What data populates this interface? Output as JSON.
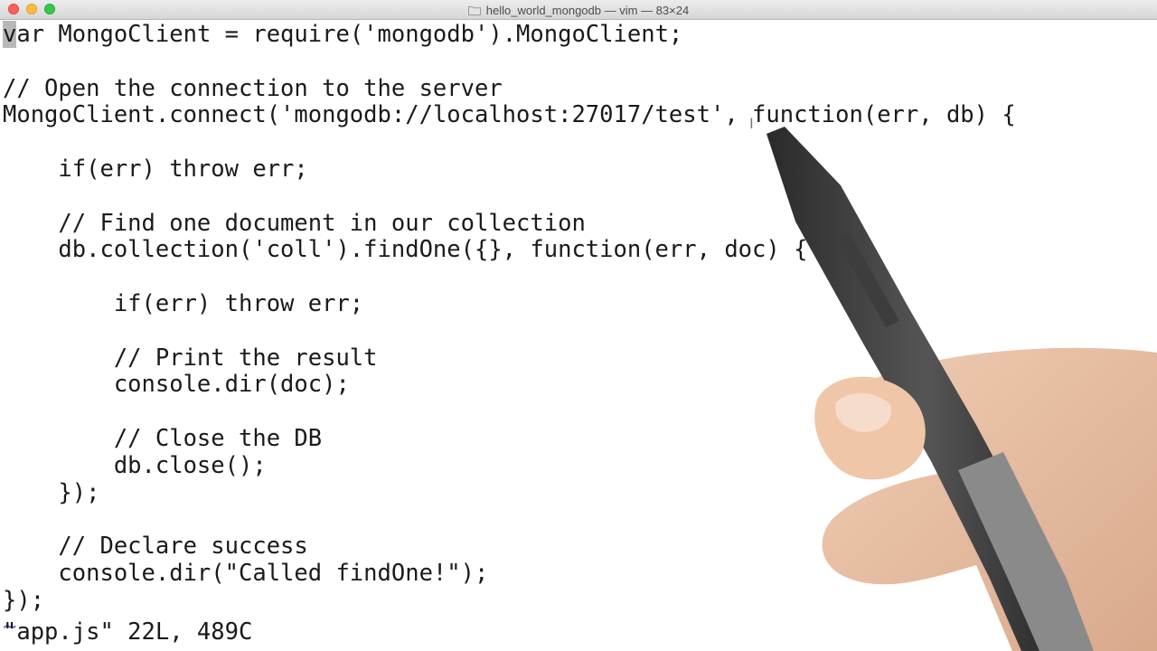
{
  "window": {
    "title": "hello_world_mongodb — vim — 83×24"
  },
  "editor": {
    "lines": [
      {
        "indent": "",
        "text": "var MongoClient = require('mongodb').MongoClient;"
      },
      {
        "indent": "",
        "text": ""
      },
      {
        "indent": "",
        "text": "// Open the connection to the server"
      },
      {
        "indent": "",
        "text": "MongoClient.connect('mongodb://localhost:27017/test', function(err, db) {"
      },
      {
        "indent": "",
        "text": ""
      },
      {
        "indent": "    ",
        "text": "if(err) throw err;"
      },
      {
        "indent": "",
        "text": ""
      },
      {
        "indent": "    ",
        "text": "// Find one document in our collection"
      },
      {
        "indent": "    ",
        "text": "db.collection('coll').findOne({}, function(err, doc) {"
      },
      {
        "indent": "",
        "text": ""
      },
      {
        "indent": "        ",
        "text": "if(err) throw err;"
      },
      {
        "indent": "",
        "text": ""
      },
      {
        "indent": "        ",
        "text": "// Print the result"
      },
      {
        "indent": "        ",
        "text": "console.dir(doc);"
      },
      {
        "indent": "",
        "text": ""
      },
      {
        "indent": "        ",
        "text": "// Close the DB"
      },
      {
        "indent": "        ",
        "text": "db.close();"
      },
      {
        "indent": "    ",
        "text": "});"
      },
      {
        "indent": "",
        "text": ""
      },
      {
        "indent": "    ",
        "text": "// Declare success"
      },
      {
        "indent": "    ",
        "text": "console.dir(\"Called findOne!\");"
      },
      {
        "indent": "",
        "text": "});"
      }
    ],
    "tilde": "~",
    "status": "\"app.js\" 22L, 489C"
  },
  "icons": {
    "folder": "folder-icon",
    "cursor": "ibeam-cursor-icon"
  },
  "colors": {
    "traffic_close": "#fc605c",
    "traffic_minimize": "#fdbc40",
    "traffic_zoom": "#34c84a",
    "tilde": "#6b6bd1"
  }
}
